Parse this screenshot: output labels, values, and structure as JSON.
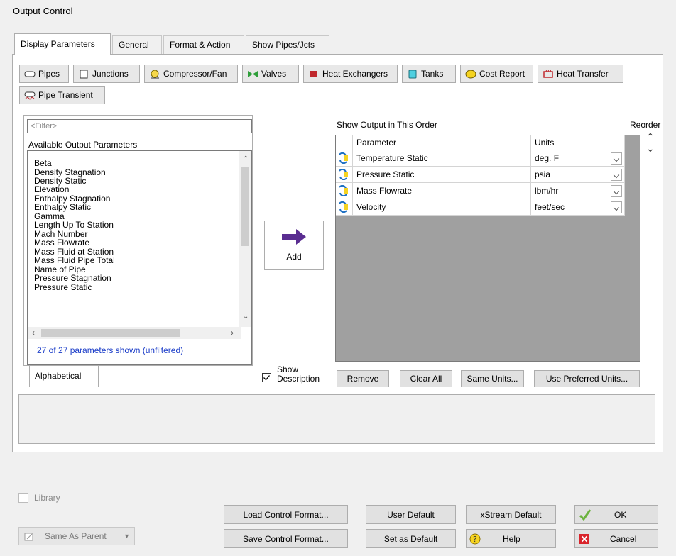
{
  "window": {
    "title": "Output Control"
  },
  "tabs": [
    {
      "label": "Display Parameters",
      "active": true
    },
    {
      "label": "General",
      "active": false
    },
    {
      "label": "Format & Action",
      "active": false
    },
    {
      "label": "Show Pipes/Jcts",
      "active": false
    }
  ],
  "category_buttons": [
    {
      "label": "Pipes",
      "icon": "pipe-icon"
    },
    {
      "label": "Junctions",
      "icon": "junction-icon"
    },
    {
      "label": "Compressor/Fan",
      "icon": "compressor-icon"
    },
    {
      "label": "Valves",
      "icon": "valve-icon"
    },
    {
      "label": "Heat Exchangers",
      "icon": "heat-exchanger-icon"
    },
    {
      "label": "Tanks",
      "icon": "tank-icon"
    },
    {
      "label": "Cost Report",
      "icon": "cost-icon"
    },
    {
      "label": "Heat Transfer",
      "icon": "heat-transfer-icon"
    },
    {
      "label": "Pipe Transient",
      "icon": "pipe-transient-icon"
    }
  ],
  "available": {
    "filter_placeholder": "<Filter>",
    "label": "Available Output Parameters",
    "items": [
      "Beta",
      "Density Stagnation",
      "Density Static",
      "Elevation",
      "Enthalpy Stagnation",
      "Enthalpy Static",
      "Gamma",
      "Length Up To Station",
      "Mach Number",
      "Mass Flowrate",
      "Mass Fluid at Station",
      "Mass Fluid Pipe Total",
      "Name of Pipe",
      "Pressure Stagnation",
      "Pressure Static"
    ],
    "count_text": "27 of 27 parameters shown (unfiltered)",
    "sort_tab": "Alphabetical"
  },
  "add_button": "Add",
  "show_description": {
    "label_line1": "Show",
    "label_line2": "Description",
    "checked": true
  },
  "output_order": {
    "label": "Show Output in This Order",
    "reorder_label": "Reorder",
    "columns": [
      "Parameter",
      "Units"
    ],
    "rows": [
      {
        "parameter": "Temperature Static",
        "units": "deg. F"
      },
      {
        "parameter": "Pressure Static",
        "units": "psia"
      },
      {
        "parameter": "Mass Flowrate",
        "units": "lbm/hr"
      },
      {
        "parameter": "Velocity",
        "units": "feet/sec"
      }
    ]
  },
  "grid_buttons": {
    "remove": "Remove",
    "clear_all": "Clear All",
    "same_units": "Same Units...",
    "preferred_units": "Use Preferred Units..."
  },
  "library": {
    "label": "Library",
    "checked": false
  },
  "same_as_parent": "Same As Parent",
  "footer": {
    "load_format": "Load Control Format...",
    "save_format": "Save Control Format...",
    "user_default": "User Default",
    "set_default": "Set as Default",
    "xstream_default": "xStream Default",
    "help": "Help",
    "ok": "OK",
    "cancel": "Cancel"
  },
  "colors": {
    "accent_link": "#1a3cc8",
    "ok_check": "#6cb33f",
    "cancel_red": "#d9242b",
    "add_arrow": "#5a2d91"
  }
}
